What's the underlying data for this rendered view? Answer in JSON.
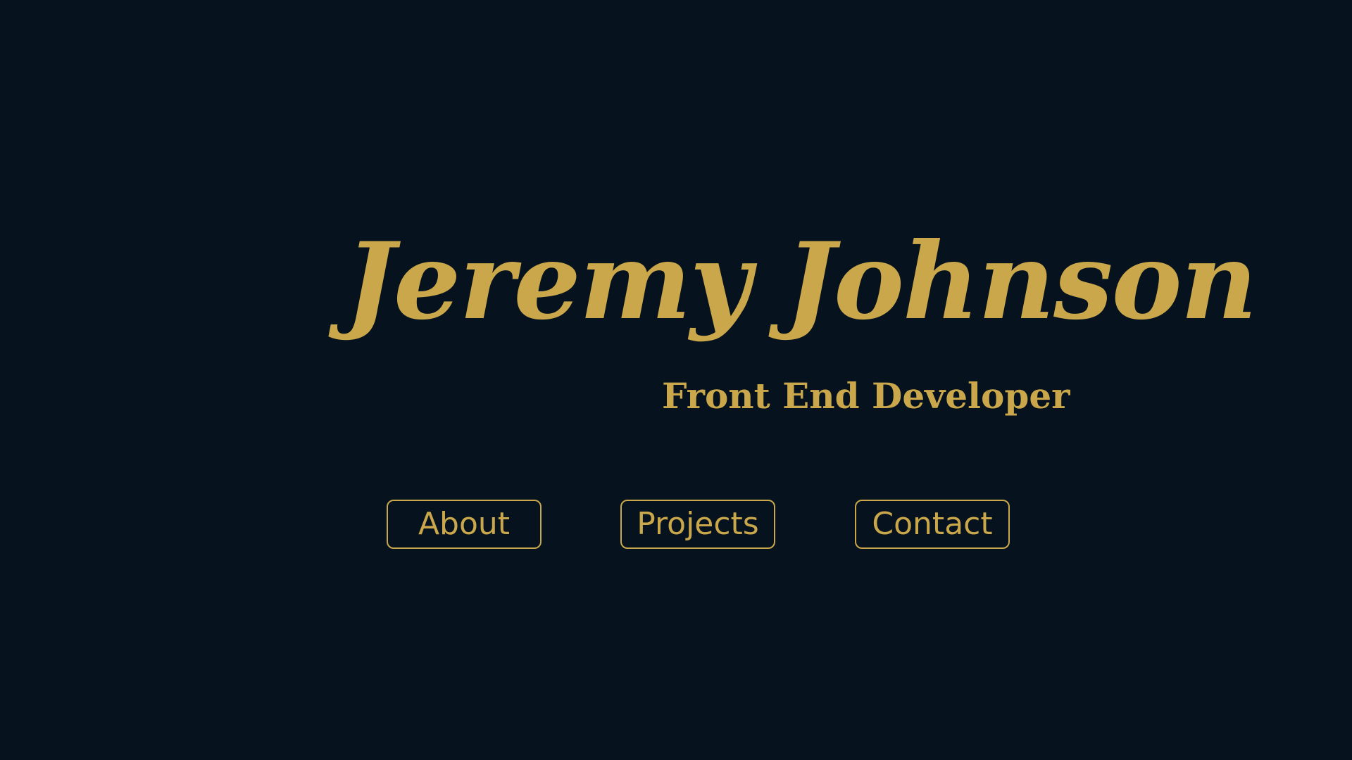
{
  "hero": {
    "name": "Jeremy Johnson",
    "subtitle": "Front End Developer"
  },
  "nav": {
    "items": [
      {
        "label": "About"
      },
      {
        "label": "Projects"
      },
      {
        "label": "Contact"
      }
    ]
  },
  "colors": {
    "background": "#06131e",
    "accent": "#c9a74a"
  }
}
